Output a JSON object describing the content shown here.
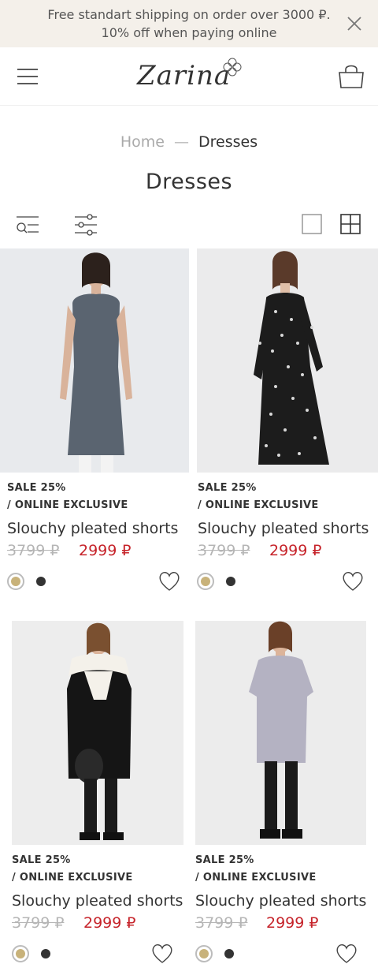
{
  "promo": {
    "line1": "Free standart shipping on order over 3000 ₽.",
    "line2": "10% off when paying online",
    "close_icon": "close-icon"
  },
  "header": {
    "menu_icon": "hamburger-menu-icon",
    "logo_text": "Zarina",
    "cart_icon": "shopping-bag-icon"
  },
  "breadcrumb": {
    "home": "Home",
    "separator": "—",
    "current": "Dresses"
  },
  "page": {
    "title": "Dresses"
  },
  "toolbar": {
    "search_icon": "search-filter-icon",
    "filter_icon": "sliders-icon",
    "single_view_icon": "single-column-view-icon",
    "grid_view_icon": "grid-view-icon"
  },
  "colors": {
    "sale": "#c6232a",
    "old_price": "#b5b5b5",
    "promo_bg": "#f4f0ea"
  },
  "products": [
    {
      "badge1": "SALE 25%",
      "badge2": "/ ONLINE EXCLUSIVE",
      "name": "Slouchy pleated shorts",
      "old_price": "3799 ₽",
      "price": "2999 ₽",
      "swatches": [
        "#c8b27a",
        "#333333"
      ],
      "dress_color": "#5a6470"
    },
    {
      "badge1": "SALE 25%",
      "badge2": "/ ONLINE EXCLUSIVE",
      "name": "Slouchy pleated shorts",
      "old_price": "3799 ₽",
      "price": "2999 ₽",
      "swatches": [
        "#c8b27a",
        "#333333"
      ],
      "dress_color": "#1c1c1c"
    },
    {
      "badge1": "SALE 25%",
      "badge2": "/ ONLINE EXCLUSIVE",
      "name": "Slouchy pleated shorts",
      "old_price": "3799 ₽",
      "price": "2999 ₽",
      "swatches": [
        "#c8b27a",
        "#333333"
      ],
      "dress_color": "#151515"
    },
    {
      "badge1": "SALE 25%",
      "badge2": "/ ONLINE EXCLUSIVE",
      "name": "Slouchy pleated shorts",
      "old_price": "3799 ₽",
      "price": "2999 ₽",
      "swatches": [
        "#c8b27a",
        "#333333"
      ],
      "dress_color": "#b4b2c2"
    }
  ]
}
